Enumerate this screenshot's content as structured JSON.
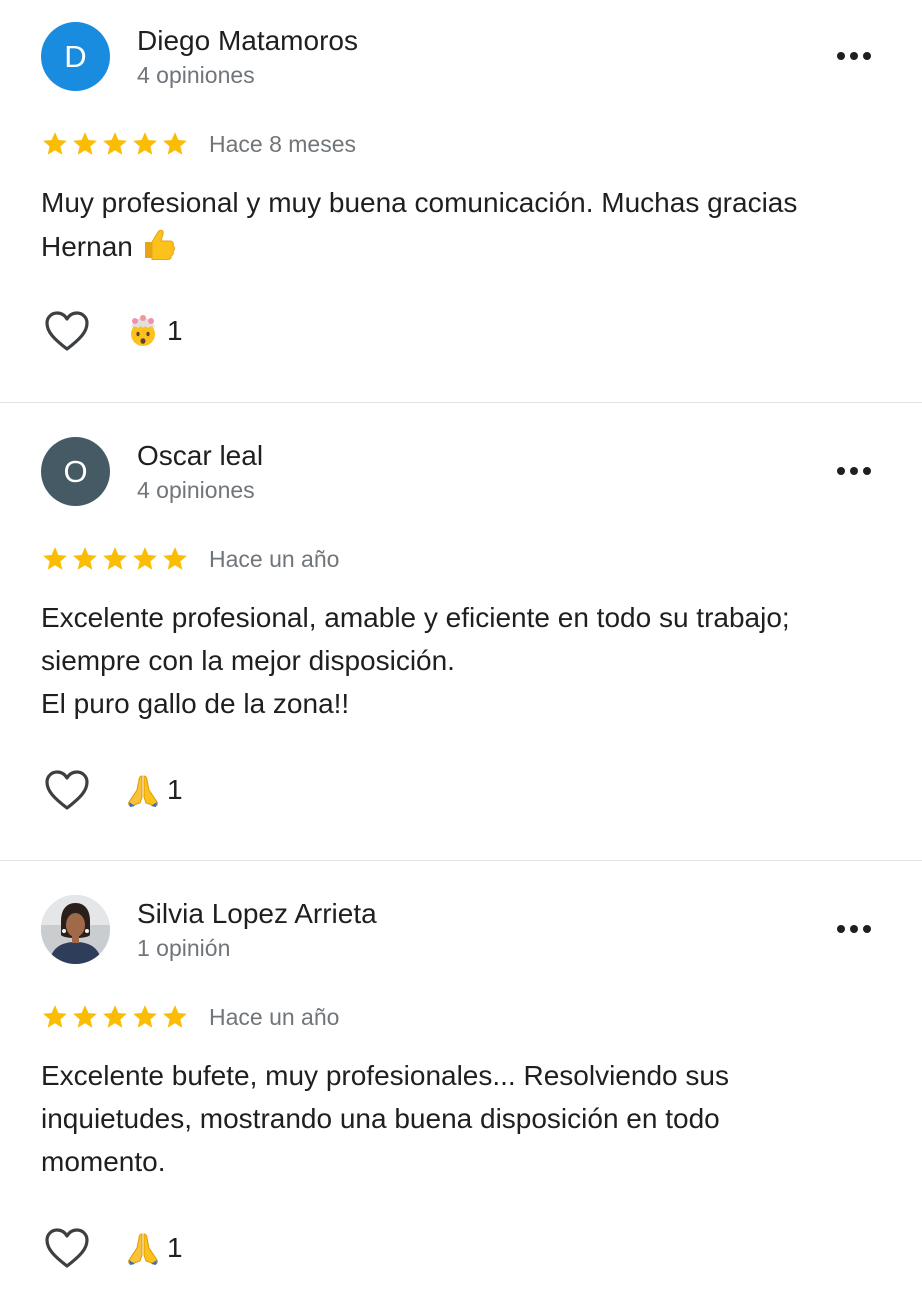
{
  "reviews": [
    {
      "author": "Diego Matamoros",
      "avatar_letter": "D",
      "avatar_color": "#1a8ce0",
      "meta": "4 opiniones",
      "rating": 5,
      "date": "Hace 8 meses",
      "text": "Muy profesional y muy buena comunicación. Muchas gracias Hernan",
      "text_emoji": "thumbs-up-emoji",
      "reaction_emoji": "exploding-head-emoji",
      "reaction_count": "1"
    },
    {
      "author": "Oscar leal",
      "avatar_letter": "O",
      "avatar_color": "#455a64",
      "meta": "4 opiniones",
      "rating": 5,
      "date": "Hace un año",
      "text": "Excelente profesional, amable y eficiente en todo su trabajo; siempre con la mejor disposición.\nEl puro gallo de la zona!!",
      "reaction_emoji": "folded-hands-emoji",
      "reaction_count": "1"
    },
    {
      "author": "Silvia Lopez Arrieta",
      "avatar_letter": "",
      "avatar_color": "#6b7a86",
      "meta": "1 opinión",
      "rating": 5,
      "date": "Hace un año",
      "text": "Excelente bufete, muy profesionales... Resolviendo sus inquietudes, mostrando una buena disposición en todo momento.",
      "reaction_emoji": "folded-hands-emoji",
      "reaction_count": "1"
    }
  ],
  "colors": {
    "star": "#fbbc04",
    "text_primary": "#1f1f1f",
    "text_secondary": "#70757a",
    "divider": "#e3e3e3"
  },
  "icons": {
    "like": "heart-outline-icon",
    "more": "more-horizontal-icon",
    "star": "star-icon"
  }
}
